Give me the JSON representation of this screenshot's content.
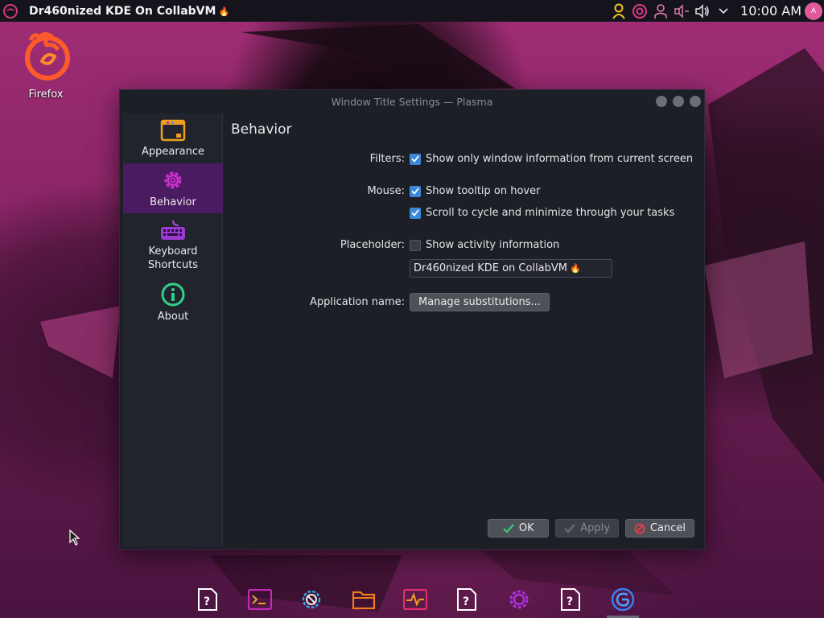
{
  "top_panel": {
    "active_window_title": "Dr460nized KDE On CollabVM",
    "title_suffix_glyph": "🔥",
    "clock": "10:00 AM",
    "user_badge": "A",
    "tray_icons": [
      "user-icon",
      "garuda-assistant-icon",
      "person-icon",
      "audio-mixer-icon",
      "volume-icon",
      "chevron-down-icon"
    ]
  },
  "desktop": {
    "icons": [
      {
        "label": "Firefox",
        "icon": "firefox-icon"
      }
    ]
  },
  "window": {
    "title": "Window Title Settings — Plasma",
    "sidebar": [
      {
        "label": "Appearance",
        "icon": "appearance-icon",
        "active": false
      },
      {
        "label": "Behavior",
        "icon": "gear-icon",
        "active": true
      },
      {
        "label": "Keyboard\nShortcuts",
        "icon": "keyboard-icon",
        "active": false
      },
      {
        "label": "About",
        "icon": "info-icon",
        "active": false
      }
    ],
    "page": {
      "heading": "Behavior",
      "filters_label": "Filters:",
      "filters_option": "Show only window information from current screen",
      "filters_checked": true,
      "mouse_label": "Mouse:",
      "mouse_tooltip": "Show tooltip on hover",
      "mouse_tooltip_checked": true,
      "mouse_scroll": "Scroll to cycle and minimize through your tasks",
      "mouse_scroll_checked": true,
      "placeholder_label": "Placeholder:",
      "placeholder_option": "Show activity information",
      "placeholder_checked": false,
      "placeholder_value": "Dr460nized KDE on CollabVM",
      "placeholder_value_glyph": "🔥",
      "appname_label": "Application name:",
      "appname_button": "Manage substitutions..."
    },
    "buttons": {
      "ok": "OK",
      "apply": "Apply",
      "cancel": "Cancel"
    }
  },
  "taskbar": {
    "items": [
      "unknown-app-icon",
      "konsole-icon",
      "network-icon",
      "dolphin-icon",
      "system-monitor-icon",
      "unknown-app-icon",
      "settings-icon",
      "unknown-app-icon",
      "garuda-icon"
    ],
    "active_index": 8
  },
  "colors": {
    "accent": "#3d87d9",
    "sidebar_active": "#4b1b62",
    "brand_magenta": "#d12fd0"
  }
}
